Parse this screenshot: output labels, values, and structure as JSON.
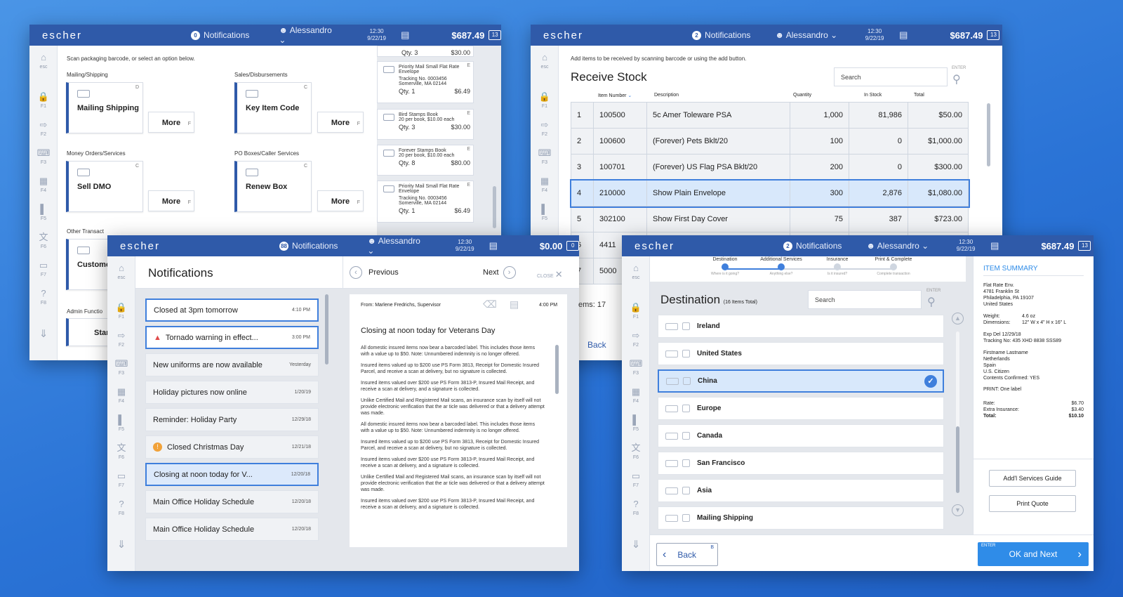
{
  "app": {
    "logo": "escher"
  },
  "w1": {
    "notif_count": "0",
    "notif_label": "Notifications",
    "user": "Alessandro",
    "time": "12:30",
    "date": "9/22/19",
    "total": "$687.49",
    "cart_count": "13",
    "instruction": "Scan packaging barcode, or select an option below.",
    "groups": [
      {
        "title": "Mailing/Shipping",
        "tile": "Mailing Shipping",
        "key": "D"
      },
      {
        "title": "Sales/Disbursements",
        "tile": "Key Item Code",
        "key": "C"
      },
      {
        "title": "Money Orders/Services",
        "tile": "Sell DMO",
        "key": "C"
      },
      {
        "title": "PO Boxes/Caller Services",
        "tile": "Renew Box",
        "key": "C"
      }
    ],
    "more_label": "More",
    "more_key": "F",
    "other_title": "Other Transact",
    "other_tile": "Custome",
    "admin_title": "Admin Functio",
    "admin_tile": "Stan",
    "receipt_top": {
      "qty": "Qty. 3",
      "price": "$30.00"
    },
    "receipts": [
      {
        "title": "Priority Mail Small Flat Rate  Envelope",
        "l2": "Tracking No. 0003456",
        "l3": "Somerville, MA 02144",
        "qty": "Qty. 1",
        "price": "$6.49",
        "key": "E"
      },
      {
        "title": "Bird Stamps Book",
        "l2": "20 per book, $10.00 each",
        "l3": "",
        "qty": "Qty. 3",
        "price": "$30.00",
        "key": "E"
      },
      {
        "title": "Forever Stamps Book",
        "l2": "20 per book, $10.00 each",
        "l3": "",
        "qty": "Qty. 8",
        "price": "$80.00",
        "key": "E"
      },
      {
        "title": "Priority Mail Small Flat Rate  Envelope",
        "l2": "Tracking No. 0003456",
        "l3": "Somerville, MA 02144",
        "qty": "Qty. 1",
        "price": "$6.49",
        "key": "E"
      }
    ]
  },
  "w2": {
    "notif_count": "2",
    "notif_label": "Notifications",
    "user": "Alessandro",
    "time": "12:30",
    "date": "9/22/19",
    "total": "$687.49",
    "cart_count": "13",
    "instruction": "Add items to be received by scanning barcode or using the add button.",
    "title": "Receive Stock",
    "search_placeholder": "Search",
    "enter_label": "ENTER",
    "columns": [
      "Item Number",
      "Description",
      "Quantity",
      "In Stock",
      "Total"
    ],
    "rows": [
      [
        "1",
        "100500",
        "5c Amer Toleware PSA",
        "1,000",
        "81,986",
        "$50.00"
      ],
      [
        "2",
        "100600",
        "(Forever) Pets Bklt/20",
        "100",
        "0",
        "$1,000.00"
      ],
      [
        "3",
        "100701",
        "(Forever) US Flag PSA Bklt/20",
        "200",
        "0",
        "$300.00"
      ],
      [
        "4",
        "210000",
        "Show Plain Envelope",
        "300",
        "2,876",
        "$1,080.00"
      ],
      [
        "5",
        "302100",
        "Show First Day Cover",
        "75",
        "387",
        "$723.00"
      ],
      [
        "6",
        "4411",
        "",
        "",
        "",
        ""
      ],
      [
        "7",
        "5000",
        "",
        "",
        "",
        ""
      ]
    ],
    "items_label": "ems: 17",
    "back_label": "Back"
  },
  "w3": {
    "notif_count": "88",
    "notif_label": "Notifications",
    "user": "Alessandro",
    "time": "12:30",
    "date": "9/22/19",
    "total": "$0.00",
    "cart_count": "0",
    "title": "Notifications",
    "previous": "Previous",
    "next": "Next",
    "close": "CLOSE",
    "items": [
      {
        "text": "Closed at 3pm tomorrow",
        "date": "4:10 PM"
      },
      {
        "text": "Tornado warning in effect...",
        "date": "3:00 PM"
      },
      {
        "text": "New uniforms are now available",
        "date": "Yesterday"
      },
      {
        "text": "Holiday pictures now online",
        "date": "1/20/19"
      },
      {
        "text": "Reminder: Holiday Party",
        "date": "12/29/18"
      },
      {
        "text": "Closed Christmas Day",
        "date": "12/21/18"
      },
      {
        "text": "Closing at noon today for V...",
        "date": "12/20/18"
      },
      {
        "text": "Main Office Holiday Schedule",
        "date": "12/20/18"
      },
      {
        "text": "Main Office Holiday Schedule",
        "date": "12/20/18"
      }
    ],
    "msg_from": "From: Marlene Fredrichs, Supervisor",
    "msg_time": "4:00 PM",
    "msg_title": "Closing at noon today for Veterans Day",
    "paras": [
      "All domestic insured items now bear a barcoded label. This includes those items with a value up to $50. Note: Unnumbered indemnity is no longer offered.",
      "Insured items valued up to $200 use PS Form 3813, Receipt for Domestic Insured Parcel, and receive a scan at delivery, but no signature is collected.",
      "Insured items valued over $200 use PS Form 3813-P, Insured Mail Receipt, and receive a scan at delivery, and a signature is collected.",
      "Unlike Certified Mail and Registered Mail scans, an insurance scan by itself will not provide electronic verification that the ar ticle was delivered or that a delivery attempt was made.",
      "All domestic insured items now bear a barcoded label. This includes those items with a value up to $50. Note: Unnumbered indemnity is no longer offered.",
      "Insured items valued up to $200 use PS Form 3813, Receipt for Domestic Insured Parcel, and receive a scan at delivery, but no signature is collected.",
      "Insured items valued over $200 use PS Form 3813-P, Insured Mail Receipt, and receive a scan at delivery, and a signature is collected.",
      "Unlike Certified Mail and Registered Mail scans, an insurance scan by itself will not provide electronic verification that the ar ticle was delivered or that a delivery attempt was made.",
      "Insured items valued over $200 use PS Form 3813-P, Insured Mail Receipt, and receive a scan at delivery, and a signature is collected."
    ]
  },
  "w4": {
    "notif_count": "2",
    "notif_label": "Notifications",
    "user": "Alessandro",
    "time": "12:30",
    "date": "9/22/19",
    "total": "$687.49",
    "cart_count": "13",
    "steps": [
      {
        "label": "Destination",
        "sub": "Where is it going?"
      },
      {
        "label": "Additional Services",
        "sub": "Anything else?"
      },
      {
        "label": "Insurance",
        "sub": "Is it insured?"
      },
      {
        "label": "Print & Complete",
        "sub": "Complete transaction"
      }
    ],
    "title": "Destination",
    "count": "(16 Items Total)",
    "search_placeholder": "Search",
    "enter_label": "ENTER",
    "destinations": [
      "Ireland",
      "United States",
      "China",
      "Europe",
      "Canada",
      "San Francisco",
      "Asia",
      "Mailing Shipping"
    ],
    "back_label": "Back",
    "back_key": "B",
    "ok_label": "OK and Next",
    "ok_key": "ENTER",
    "summary": {
      "title": "ITEM SUMMARY",
      "addr": [
        "Flat Rate Env.",
        "4781 Franklin St",
        "Philadelphia, PA 19107",
        "United States"
      ],
      "weight_k": "Weight:",
      "weight_v": "4.6 oz",
      "dim_k": "Dimensions:",
      "dim_v": "12\" W x 4\" H x 16\" L",
      "exp": "Exp Del 12/29/18",
      "track": "Tracking No: 435 XHD 8838 SSS89",
      "person": [
        "Firstname Lastname",
        "Netherlands",
        "Spain",
        "U.S. Citizen",
        "Contents Confirmed: YES"
      ],
      "print": "PRINT: One label",
      "rate_k": "Rate:",
      "rate_v": "$6.70",
      "ins_k": "Extra Insurance:",
      "ins_v": "$3.40",
      "tot_k": "Total:",
      "tot_v": "$10.10",
      "btn1": "Add'l Services Guide",
      "btn2": "Print Quote"
    }
  },
  "sidebar_keys": [
    "esc",
    "F1",
    "F2",
    "F3",
    "F4",
    "F5",
    "F6",
    "F7",
    "F8"
  ]
}
